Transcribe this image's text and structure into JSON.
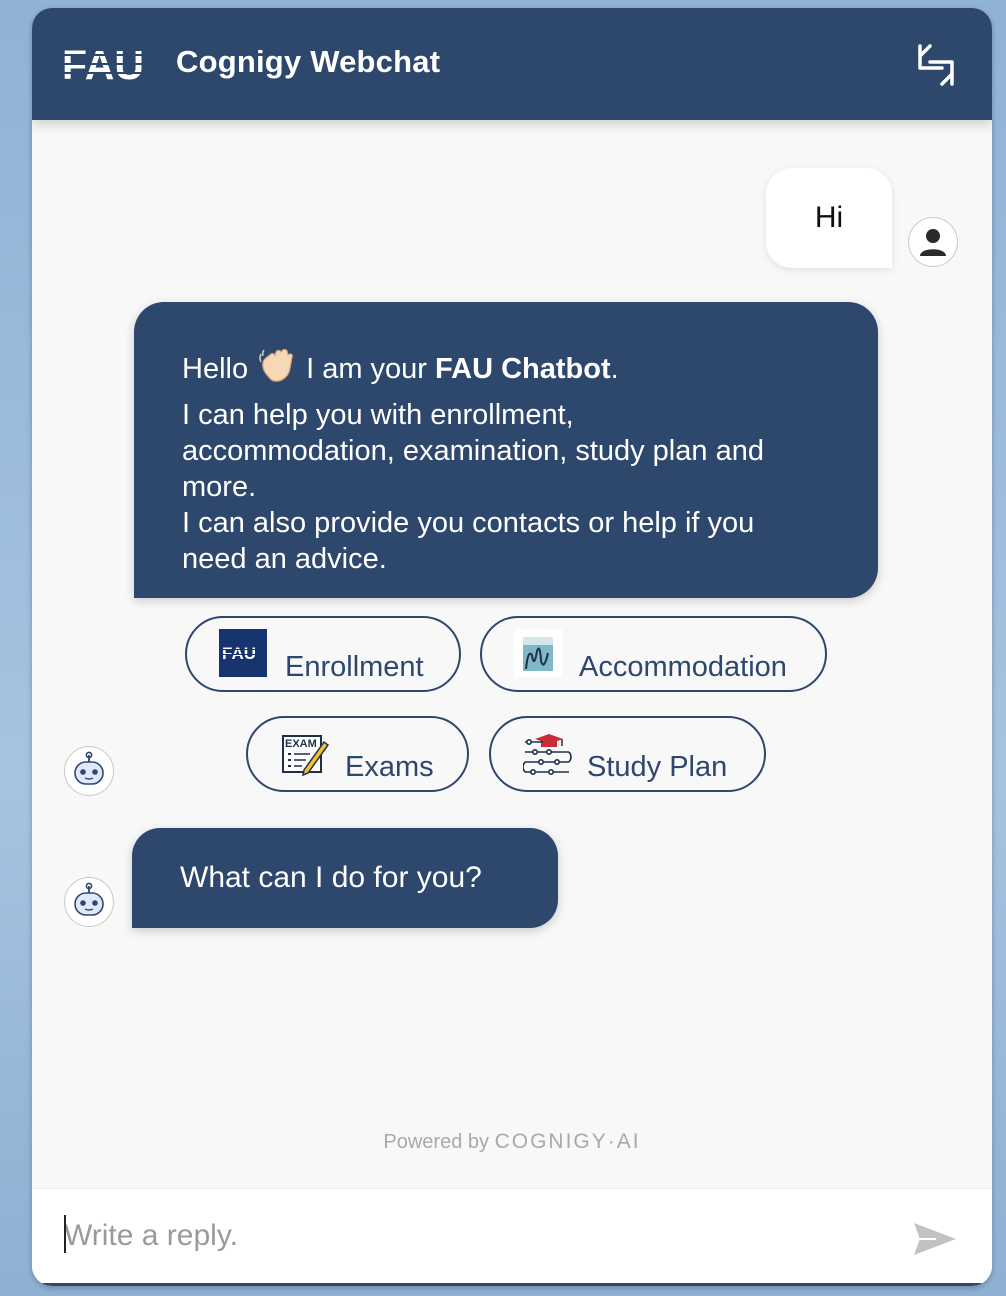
{
  "header": {
    "logo_text": "FAU",
    "title": "Cognigy Webchat",
    "collapse_icon": "collapse-icon"
  },
  "messages": {
    "user_greeting": "Hi",
    "bot_intro": {
      "hello": "Hello",
      "wave_icon": "waving-hand-icon",
      "i_am_your": "I am your",
      "bot_name": "FAU Chatbot",
      "period": ".",
      "line2": "I can help you with enrollment,",
      "line3": "accommodation, examination, study plan and",
      "line4": "more.",
      "line5": "I can also provide you contacts or  help if you",
      "line6": "need an advice."
    },
    "bot_question": "What can I do for you?"
  },
  "quick_replies": [
    {
      "label": "Enrollment",
      "icon": "fau-logo-icon"
    },
    {
      "label": "Accommodation",
      "icon": "accommodation-icon"
    },
    {
      "label": "Exams",
      "icon": "exam-icon"
    },
    {
      "label": "Study Plan",
      "icon": "study-plan-icon"
    }
  ],
  "footer": {
    "powered_by": "Powered by",
    "brand": "COGNIGY·AI"
  },
  "input": {
    "placeholder": "Write a reply.",
    "send_icon": "send-icon"
  },
  "colors": {
    "primary": "#2e476d",
    "background": "#f8f8f8",
    "page_background": "#9dbbdc"
  }
}
